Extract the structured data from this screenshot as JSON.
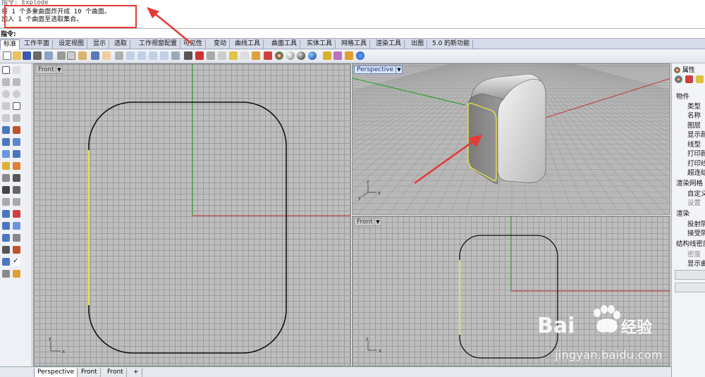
{
  "history": {
    "lines": [
      "指令: Explode",
      "将 1 个多重曲面炸开成 10 个曲面。",
      "加入 1 个曲面至选取集合。"
    ]
  },
  "command": {
    "label": "指令:",
    "value": ""
  },
  "toolbar_tabs": [
    "标准",
    "工作平面",
    "设定视图",
    "显示",
    "选取",
    "工作视窗配置",
    "可见性",
    "变动",
    "曲线工具",
    "曲面工具",
    "实体工具",
    "网格工具",
    "渲染工具",
    "出图",
    "5.0 的新功能"
  ],
  "active_toolbar_tab": "标准",
  "viewports": {
    "front_main": {
      "title": "Front"
    },
    "perspective": {
      "title": "Perspective"
    },
    "front_small": {
      "title": "Front"
    },
    "dropdown_icon": "chevron-down-icon"
  },
  "axis_labels": {
    "z": "z",
    "x": "x",
    "y": "y"
  },
  "properties_panel": {
    "tabs": [
      "属性"
    ],
    "sections": [
      {
        "title": "物件",
        "items": [
          "类型",
          "名称",
          "图层",
          "显示颜",
          "线型",
          "打印颜",
          "打印线",
          "超连结"
        ]
      },
      {
        "title": "渲染网格",
        "items": [
          "自定义",
          "设置"
        ]
      },
      {
        "title": "渲染",
        "items": [
          "投射阴",
          "接受阴"
        ]
      },
      {
        "title": "结构线密度",
        "items": [
          "密度",
          "显示曲"
        ]
      }
    ],
    "disabled_items": [
      "设置",
      "密度"
    ]
  },
  "bottom_tabs": [
    "Perspective",
    "Front",
    "Front",
    "+"
  ],
  "active_bottom_tab": "Perspective",
  "watermark": {
    "brand": "Bai du 经验",
    "url": "jingyan.baidu.com"
  },
  "colors": {
    "annotation_red": "#e53935",
    "selection_yellow": "#e8e04a",
    "axis_green": "#1aa01a",
    "axis_red": "#c03030",
    "viewport_bg": "#bebebe"
  }
}
